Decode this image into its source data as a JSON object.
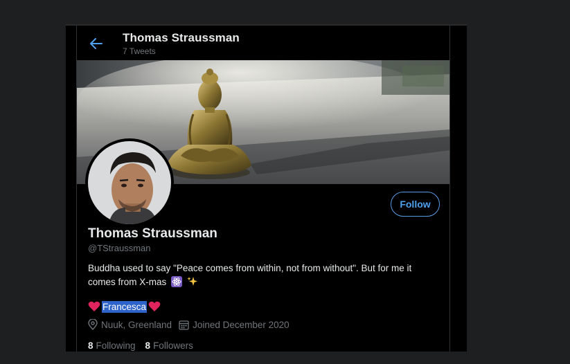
{
  "header": {
    "title": "Thomas Straussman",
    "tweet_count": "7 Tweets"
  },
  "profile": {
    "name": "Thomas Straussman",
    "handle": "@TStraussman",
    "follow_label": "Follow",
    "bio": "Buddha used to say \"Peace comes from within, not from without\". But for me it comes from X-mas",
    "partner_name": "Francesca",
    "location": "Nuuk, Greenland",
    "joined": "Joined December 2020",
    "following_count": "8",
    "following_label": "Following",
    "followers_count": "8",
    "followers_label": "Followers"
  },
  "icons": {
    "back": "arrow-left-icon",
    "location": "location-pin-icon",
    "calendar": "calendar-icon",
    "heart": "heart-icon",
    "atom": "atom-icon",
    "sparkles": "sparkles-icon"
  },
  "colors": {
    "accent": "#1d9bf0",
    "heart": "#e0245e",
    "selection": "#2e63c9"
  }
}
